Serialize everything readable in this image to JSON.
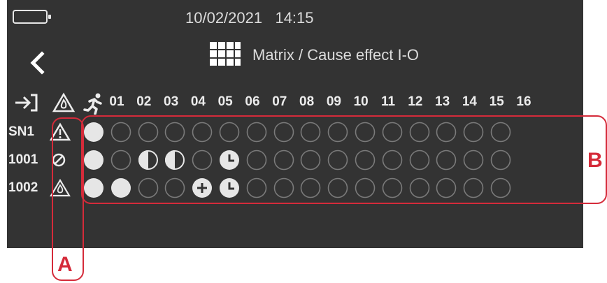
{
  "status": {
    "date": "10/02/2021",
    "time": "14:15",
    "battery_icon": "battery-empty-icon"
  },
  "nav": {
    "back_icon": "chevron-left-icon",
    "menu_icon": "grid-icon",
    "title": "Matrix / Cause effect I-O"
  },
  "header": {
    "icons": [
      "input-arrow-icon",
      "fire-warning-icon",
      "running-person-icon"
    ],
    "columns": [
      "01",
      "02",
      "03",
      "04",
      "05",
      "06",
      "07",
      "08",
      "09",
      "10",
      "11",
      "12",
      "13",
      "14",
      "15",
      "16"
    ]
  },
  "rows": [
    {
      "label": "SN1",
      "type_icon": "warning-icon",
      "cells": [
        "full",
        "empty",
        "empty",
        "empty",
        "empty",
        "empty",
        "empty",
        "empty",
        "empty",
        "empty",
        "empty",
        "empty",
        "empty",
        "empty",
        "empty",
        "empty"
      ]
    },
    {
      "label": "1001",
      "type_icon": "disabled-icon",
      "cells": [
        "full",
        "empty",
        "half",
        "half",
        "empty",
        "clock",
        "empty",
        "empty",
        "empty",
        "empty",
        "empty",
        "empty",
        "empty",
        "empty",
        "empty",
        "empty"
      ]
    },
    {
      "label": "1002",
      "type_icon": "fire-warning-icon",
      "cells": [
        "full",
        "full",
        "empty",
        "empty",
        "plus",
        "clock",
        "empty",
        "empty",
        "empty",
        "empty",
        "empty",
        "empty",
        "empty",
        "empty",
        "empty",
        "empty"
      ]
    }
  ],
  "annotations": {
    "a_label": "A",
    "b_label": "B",
    "color": "#d52b3a"
  },
  "colors": {
    "screen_bg": "#333333",
    "foreground": "#e6e6e6",
    "empty_ring": "#7a7a7a"
  }
}
